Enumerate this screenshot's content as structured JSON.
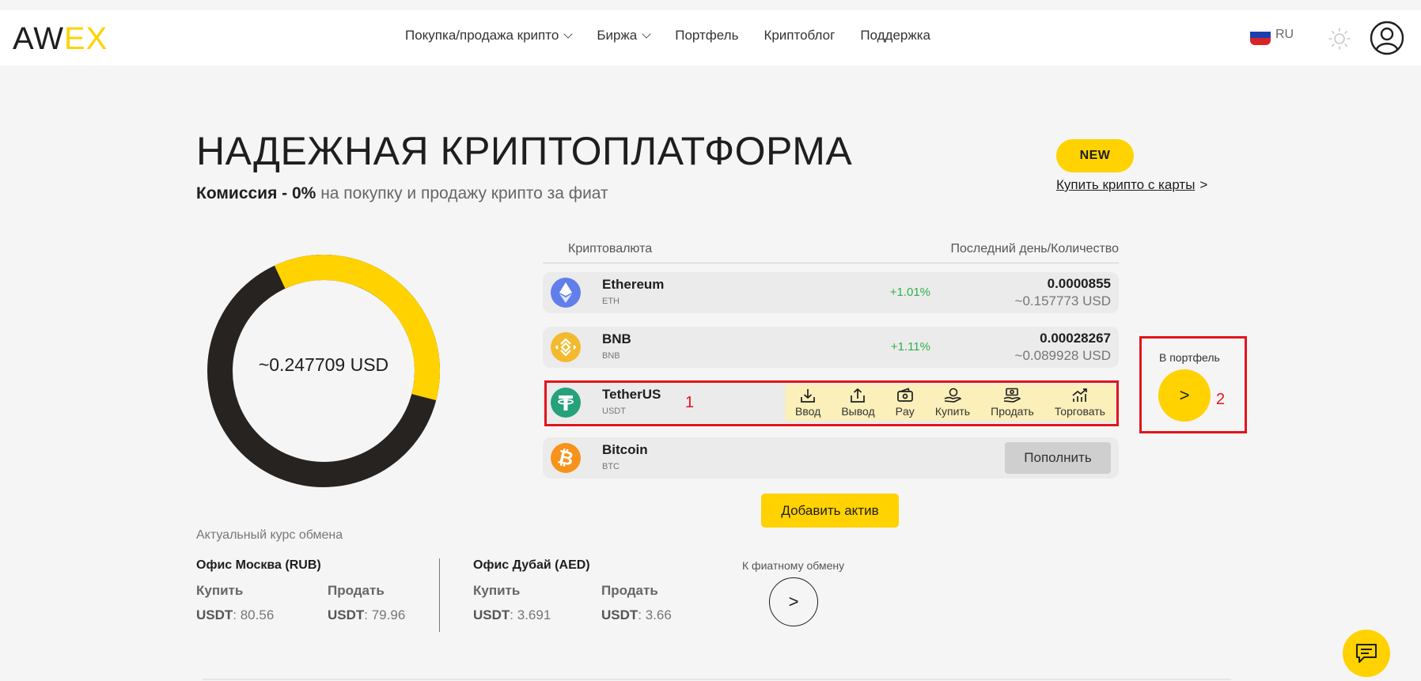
{
  "header": {
    "logo_text_1": "AW",
    "logo_text_2": "EX",
    "nav": [
      {
        "label": "Покупка/продажа крипто",
        "dropdown": true
      },
      {
        "label": "Биржа",
        "dropdown": true
      },
      {
        "label": "Портфель",
        "dropdown": false
      },
      {
        "label": "Криптоблог",
        "dropdown": false
      },
      {
        "label": "Поддержка",
        "dropdown": false
      }
    ],
    "language": "RU",
    "icons": {
      "theme": "sun-icon",
      "profile": "user-icon"
    }
  },
  "hero": {
    "title": "НАДЕЖНАЯ КРИПТОПЛАТФОРМА",
    "subtitle_bold": "Комиссия - 0%",
    "subtitle_rest": " на покупку и продажу крипто за фиат",
    "badge": "NEW",
    "buy_link": "Купить крипто с карты",
    "buy_link_arrow": ">"
  },
  "portfolio": {
    "total": "~0.247709 USD",
    "donut_fraction": 0.36,
    "colors": {
      "accent": "#ffd200",
      "dark": "#272320"
    }
  },
  "table": {
    "col_currency": "Криптовалюта",
    "col_amount": "Последний день/Количество",
    "rows": [
      {
        "name": "Ethereum",
        "symbol": "ETH",
        "change": "+1.01%",
        "amount": "0.0000855",
        "usd": "~0.157773 USD",
        "icon_color": "#627eea"
      },
      {
        "name": "BNB",
        "symbol": "BNB",
        "change": "+1.11%",
        "amount": "0.00028267",
        "usd": "~0.089928 USD",
        "icon_color": "#f3ba2f"
      },
      {
        "name": "TetherUS",
        "symbol": "USDT",
        "icon_color": "#26a17b",
        "actions": [
          "Ввод",
          "Вывод",
          "Pay",
          "Купить",
          "Продать",
          "Торговать"
        ]
      },
      {
        "name": "Bitcoin",
        "symbol": "BTC",
        "button": "Пополнить",
        "icon_color": "#f7931a"
      }
    ],
    "add_asset": "Добавить актив"
  },
  "annotations": {
    "box1": "1",
    "box2": "2"
  },
  "side": {
    "to_portfolio": "В портфель",
    "arrow": ">"
  },
  "rates": {
    "title": "Актуальный курс обмена",
    "offices": [
      {
        "name": "Офис Москва (RUB)",
        "buy_label": "Купить",
        "sell_label": "Продать",
        "asset": "USDT",
        "buy": ": 80.56",
        "sell": ": 79.96"
      },
      {
        "name": "Офис Дубай (AED)",
        "buy_label": "Купить",
        "sell_label": "Продать",
        "asset": "USDT",
        "buy": ": 3.691",
        "sell": ": 3.66"
      }
    ],
    "fiat_label": "К фиатному обмену",
    "fiat_arrow": ">"
  }
}
